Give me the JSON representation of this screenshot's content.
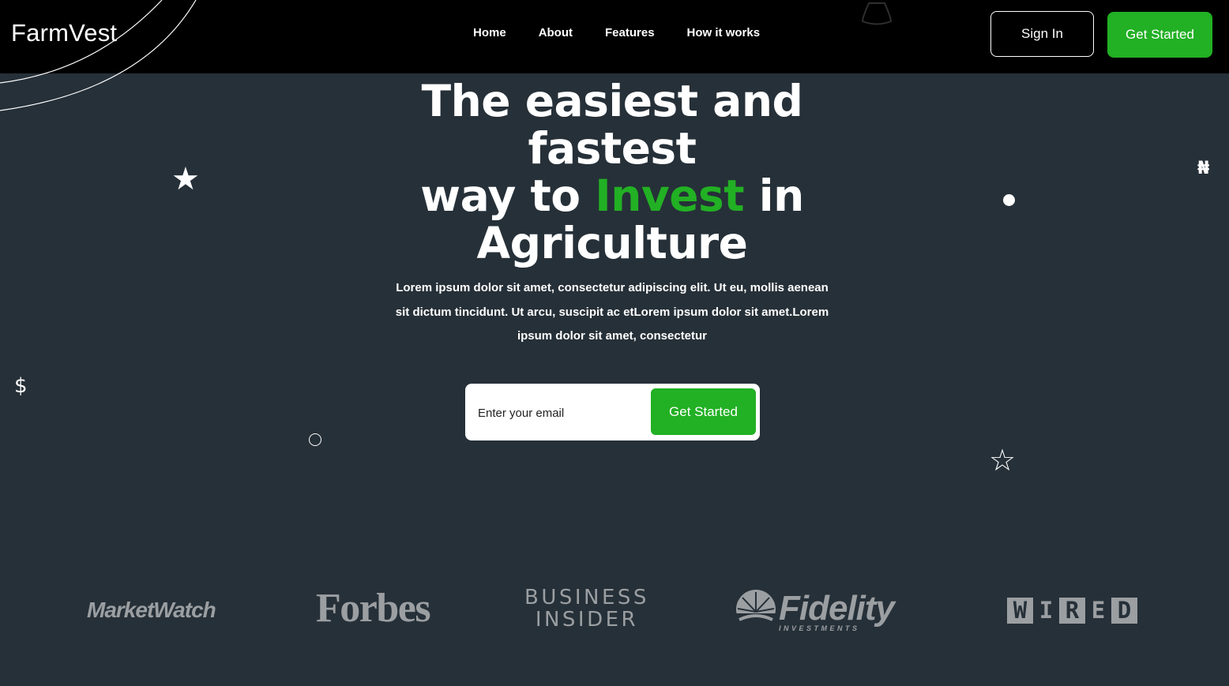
{
  "brand": {
    "name": "FarmVest"
  },
  "nav": {
    "links": [
      "Home",
      "About",
      "Features",
      "How it works"
    ],
    "sign_in": "Sign In",
    "get_started": "Get Started"
  },
  "hero": {
    "title_line1": "The easiest and fastest",
    "title_line2_pre": "way to ",
    "title_accent": "Invest",
    "title_line2_post": " in",
    "title_line3": "Agriculture",
    "description": "Lorem ipsum dolor sit amet, consectetur adipiscing elit. Ut eu, mollis aenean sit dictum tincidunt. Ut arcu, suscipit ac etLorem ipsum dolor sit amet.Lorem ipsum dolor sit amet, consectetur",
    "email_placeholder": "Enter your email",
    "cta": "Get Started"
  },
  "decorations": {
    "naira": "₦",
    "dollar": "$",
    "star_filled": "★",
    "star_outline": "☆"
  },
  "press": {
    "marketwatch": "MarketWatch",
    "forbes": "Forbes",
    "business_insider_line1": "BUSINESS",
    "business_insider_line2": "INSIDER",
    "fidelity": "Fidelity",
    "fidelity_sub": "INVESTMENTS",
    "wired": [
      "W",
      "I",
      "R",
      "E",
      "D"
    ]
  },
  "colors": {
    "accent": "#22b024",
    "background": "#263038",
    "nav_background": "#000000",
    "press_logo": "#9b9fa2"
  }
}
